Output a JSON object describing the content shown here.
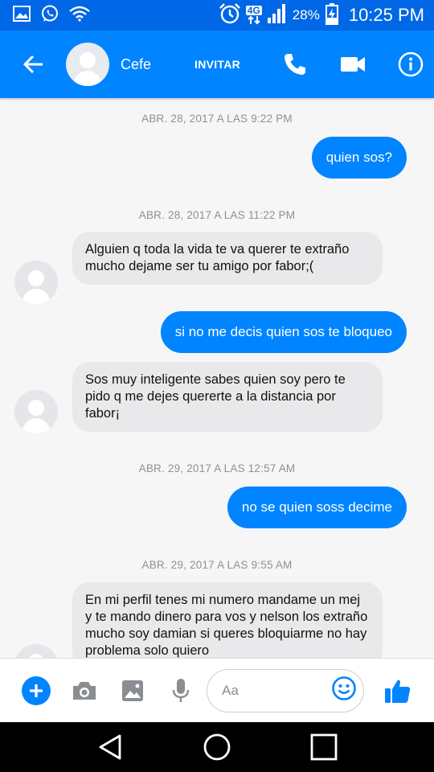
{
  "status_bar": {
    "battery": "28%",
    "time": "10:25 PM",
    "network": "4G"
  },
  "header": {
    "contact_name": "Cefe",
    "invite_label": "INVITAR",
    "icons": [
      "back-arrow-icon",
      "phone-icon",
      "video-camera-icon",
      "info-icon"
    ]
  },
  "messages": [
    {
      "kind": "timestamp",
      "text": "ABR. 28, 2017 A LAS 9:22 PM"
    },
    {
      "kind": "outgoing",
      "text": "quien sos?"
    },
    {
      "kind": "timestamp",
      "text": "ABR. 28, 2017 A LAS 11:22 PM"
    },
    {
      "kind": "incoming",
      "text": "Alguien q toda la vida te va querer  te extraño mucho dejame ser tu amigo por fabor;("
    },
    {
      "kind": "outgoing",
      "text": "si no me decis quien sos te bloqueo"
    },
    {
      "kind": "incoming",
      "text": "Sos muy inteligente sabes quien soy pero te pido q me dejes quererte a la distancia por fabor¡"
    },
    {
      "kind": "timestamp",
      "text": "ABR. 29, 2017 A LAS 12:57 AM"
    },
    {
      "kind": "outgoing",
      "text": "no se quien soss decime"
    },
    {
      "kind": "timestamp",
      "text": "ABR. 29, 2017 A LAS 9:55 AM"
    },
    {
      "kind": "incoming",
      "text": "En mi perfil tenes mi numero mandame un mej y te mando dinero para vos y nelson los extraño mucho soy damian si queres bloquiarme no hay problema solo quiero"
    }
  ],
  "composer": {
    "placeholder": "Aa",
    "icons": [
      "plus-icon",
      "camera-icon",
      "image-icon",
      "microphone-icon",
      "emoji-icon",
      "thumbs-up-icon"
    ]
  },
  "nav_bar": {
    "icons": [
      "back-triangle-icon",
      "home-circle-icon",
      "recents-square-icon"
    ]
  },
  "colors": {
    "status_bar": "#0067e6",
    "app_bar": "#0084ff",
    "outgoing_bubble": "#0084ff",
    "incoming_bubble": "#e9e9eb",
    "timestamp_text": "#8d9094"
  }
}
